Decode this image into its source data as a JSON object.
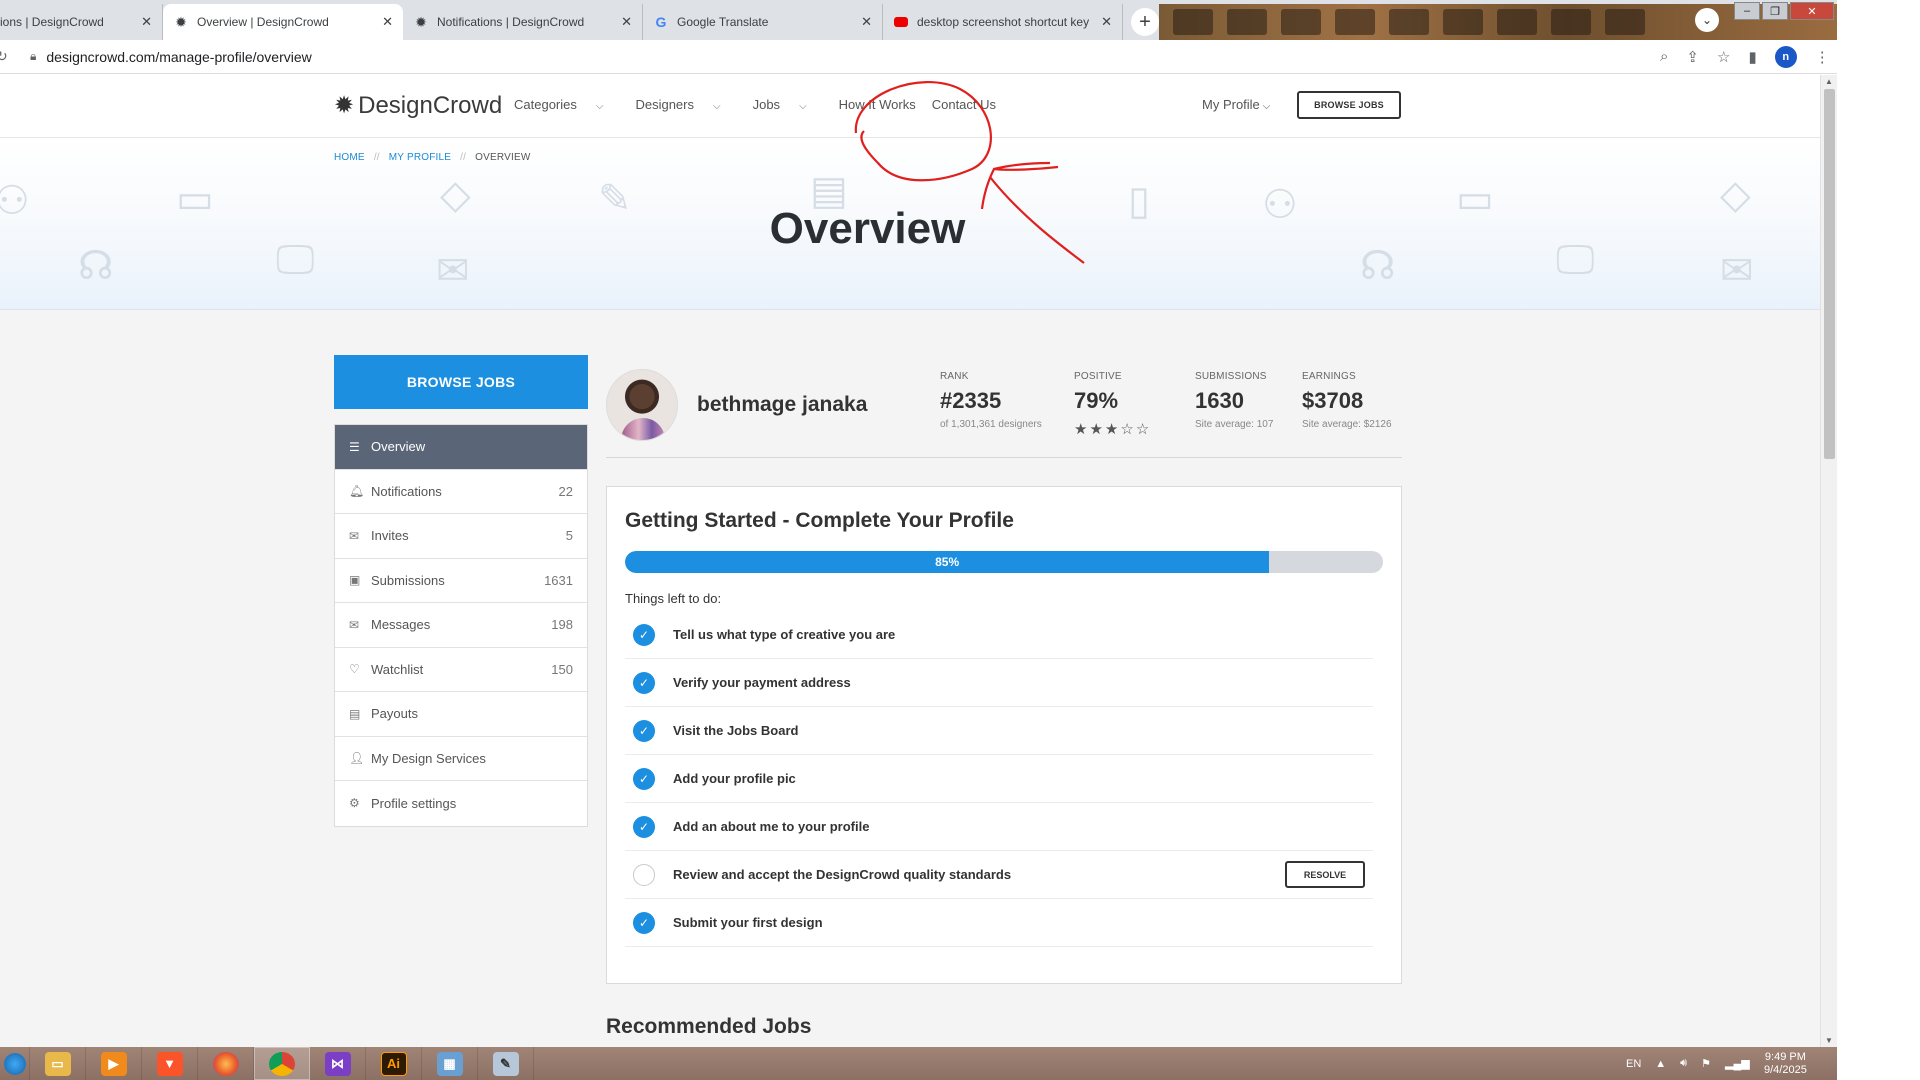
{
  "browser": {
    "tabs": [
      {
        "title": "ions | DesignCrowd",
        "icon": "designcrowd-icon",
        "active": false
      },
      {
        "title": "Overview | DesignCrowd",
        "icon": "designcrowd-icon",
        "active": true
      },
      {
        "title": "Notifications | DesignCrowd",
        "icon": "designcrowd-icon",
        "active": false
      },
      {
        "title": "Google Translate",
        "icon": "google-translate-icon",
        "active": false
      },
      {
        "title": "desktop screenshot shortcut key",
        "icon": "youtube-icon",
        "active": false
      }
    ],
    "url": "designcrowd.com/manage-profile/overview",
    "profile_initial": "n"
  },
  "site": {
    "logo": "DesignCrowd",
    "nav": [
      {
        "label": "Categories",
        "dropdown": true
      },
      {
        "label": "Designers",
        "dropdown": true
      },
      {
        "label": "Jobs",
        "dropdown": true
      },
      {
        "label": "How It Works",
        "dropdown": false
      },
      {
        "label": "Contact Us",
        "dropdown": false
      }
    ],
    "my_profile": "My Profile",
    "browse_jobs_top": "BROWSE JOBS"
  },
  "hero": {
    "breadcrumb": [
      "HOME",
      "MY PROFILE",
      "OVERVIEW"
    ],
    "title": "Overview"
  },
  "sidebar": {
    "browse_jobs": "BROWSE JOBS",
    "items": [
      {
        "label": "Overview",
        "count": "",
        "icon": "list-icon",
        "active": true
      },
      {
        "label": "Notifications",
        "count": "22",
        "icon": "bell-icon",
        "active": false
      },
      {
        "label": "Invites",
        "count": "5",
        "icon": "envelope-open-icon",
        "active": false
      },
      {
        "label": "Submissions",
        "count": "1631",
        "icon": "monitor-icon",
        "active": false
      },
      {
        "label": "Messages",
        "count": "198",
        "icon": "mail-icon",
        "active": false
      },
      {
        "label": "Watchlist",
        "count": "150",
        "icon": "heart-icon",
        "active": false
      },
      {
        "label": "Payouts",
        "count": "",
        "icon": "money-icon",
        "active": false
      },
      {
        "label": "My Design Services",
        "count": "",
        "icon": "user-icon",
        "active": false
      },
      {
        "label": "Profile settings",
        "count": "",
        "icon": "gear-icon",
        "active": false
      }
    ]
  },
  "profile": {
    "name": "bethmage janaka",
    "stats": {
      "rank_label": "RANK",
      "rank_value": "#2335",
      "rank_sub": "of 1,301,361 designers",
      "positive_label": "POSITIVE",
      "positive_value": "79%",
      "positive_stars": 3,
      "positive_stars_max": 5,
      "submissions_label": "SUBMISSIONS",
      "submissions_value": "1630",
      "submissions_sub": "Site average: 107",
      "earnings_label": "EARNINGS",
      "earnings_value": "$3708",
      "earnings_sub": "Site average: $2126"
    }
  },
  "getting_started": {
    "title": "Getting Started - Complete Your Profile",
    "progress_percent": 85,
    "progress_label": "85%",
    "left_label": "Things left to do:",
    "resolve_label": "RESOLVE",
    "items": [
      {
        "text": "Tell us what type of creative you are",
        "done": true
      },
      {
        "text": "Verify your payment address",
        "done": true
      },
      {
        "text": "Visit the Jobs Board",
        "done": true
      },
      {
        "text": "Add your profile pic",
        "done": true
      },
      {
        "text": "Add an about me to your profile",
        "done": true
      },
      {
        "text": "Review and accept the DesignCrowd quality standards",
        "done": false
      },
      {
        "text": "Submit your first design",
        "done": true
      }
    ]
  },
  "recommended_title": "Recommended Jobs",
  "taskbar": {
    "apps": [
      "windows-start-icon",
      "file-explorer-icon",
      "media-player-icon",
      "brave-icon",
      "firefox-icon",
      "chrome-icon",
      "visual-studio-icon",
      "illustrator-icon",
      "photos-icon",
      "paint-icon"
    ],
    "illustrator_label": "Ai",
    "language": "EN",
    "time": "9:49 PM",
    "date": "9/4/2025"
  },
  "colors": {
    "accent": "#1c8fe0",
    "active_menu": "#5a6577",
    "annotation": "#e0201c"
  }
}
